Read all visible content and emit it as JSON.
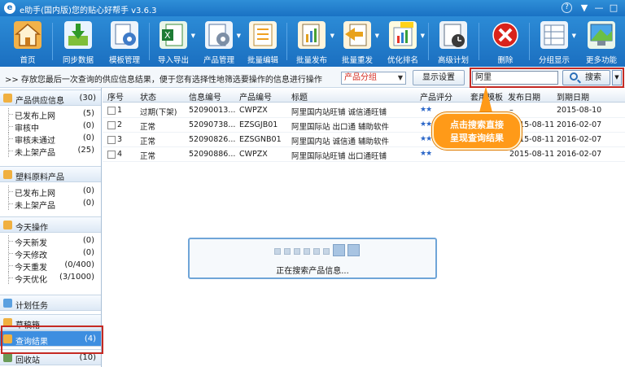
{
  "window": {
    "title": "e助手(国内版)您的贴心好帮手  v3.6.3",
    "help_glyph": "?",
    "menu_glyph": "▼",
    "min_glyph": "—",
    "max_glyph": "□"
  },
  "toolbar": {
    "items": [
      {
        "label": "首页",
        "icon": "home-icon"
      },
      {
        "label": "同步数据",
        "icon": "sync-icon"
      },
      {
        "label": "模板管理",
        "icon": "template-icon"
      },
      {
        "label": "导入导出",
        "icon": "excel-icon"
      },
      {
        "label": "产品管理",
        "icon": "gear-icon"
      },
      {
        "label": "批量编辑",
        "icon": "edit-icon"
      },
      {
        "label": "批量发布",
        "icon": "publish-icon"
      },
      {
        "label": "批量重发",
        "icon": "republish-icon"
      },
      {
        "label": "优化排名",
        "icon": "rank-icon"
      },
      {
        "label": "高级计划",
        "icon": "schedule-icon"
      },
      {
        "label": "删除",
        "icon": "delete-icon"
      },
      {
        "label": "分组显示",
        "icon": "group-icon"
      },
      {
        "label": "更多功能",
        "icon": "more-icon"
      }
    ],
    "dropdown_glyph": "▼"
  },
  "strip": {
    "message": ">>  存放您最后一次查询的供应信息结果，便于您有选择性地筛选要操作的信息进行操作",
    "group_select": "产品分组",
    "display_settings": "显示设置",
    "search_value": "阿里",
    "search_button": "搜索",
    "dropdown_glyph": "▼"
  },
  "sidebar": {
    "sections": [
      {
        "title": "产品供应信息",
        "count": "(30)",
        "items": [
          {
            "label": "已发布上网",
            "count": "(5)"
          },
          {
            "label": "审核中",
            "count": "(0)"
          },
          {
            "label": "审核未通过",
            "count": "(0)"
          },
          {
            "label": "未上架产品",
            "count": "(25)"
          }
        ]
      },
      {
        "title": "塑料原料产品",
        "count": "",
        "items": [
          {
            "label": "已发布上网",
            "count": "(0)"
          },
          {
            "label": "未上架产品",
            "count": "(0)"
          }
        ]
      },
      {
        "title": "今天操作",
        "count": "",
        "items": [
          {
            "label": "今天新发",
            "count": "(0)"
          },
          {
            "label": "今天修改",
            "count": "(0)"
          },
          {
            "label": "今天重发",
            "count": "(0/400)"
          },
          {
            "label": "今天优化",
            "count": "(3/1000)"
          }
        ]
      },
      {
        "title": "计划任务",
        "count": ""
      },
      {
        "title": "草稿箱",
        "count": ""
      },
      {
        "title": "查询结果",
        "count": "(4)"
      },
      {
        "title": "回收站",
        "count": "(10)"
      }
    ]
  },
  "table": {
    "headers": [
      "序号",
      "状态",
      "信息编号",
      "产品编号",
      "标题",
      "产品评分",
      "套用模板",
      "发布日期",
      "到期日期"
    ],
    "rows": [
      {
        "no": "1",
        "status": "过期(下架)",
        "info_id": "52090013...",
        "product_id": "CWPZX",
        "title": "阿里国内站旺铺 诚信通旺铺",
        "rating": "★★",
        "template": "",
        "publish": "–",
        "expire": "2015-08-10"
      },
      {
        "no": "2",
        "status": "正常",
        "info_id": "52090738...",
        "product_id": "EZSGJB01",
        "title": "阿里国际站 出口通 辅助软件",
        "rating": "★★",
        "template": "",
        "publish": "2015-08-11",
        "expire": "2016-02-07"
      },
      {
        "no": "3",
        "status": "正常",
        "info_id": "52090826...",
        "product_id": "EZSGNB01",
        "title": "阿里国内站 诚信通 辅助软件",
        "rating": "★★",
        "template": "",
        "publish": "2015-08-11",
        "expire": "2016-02-07"
      },
      {
        "no": "4",
        "status": "正常",
        "info_id": "52090886...",
        "product_id": "CWPZX",
        "title": "阿里国际站旺铺 出口通旺铺",
        "rating": "★★",
        "template": "",
        "publish": "2015-08-11",
        "expire": "2016-02-07"
      }
    ]
  },
  "callout": {
    "line1": "点击搜索直接",
    "line2": "呈现查询结果"
  },
  "progress": {
    "text": "正在搜索产品信息..."
  }
}
